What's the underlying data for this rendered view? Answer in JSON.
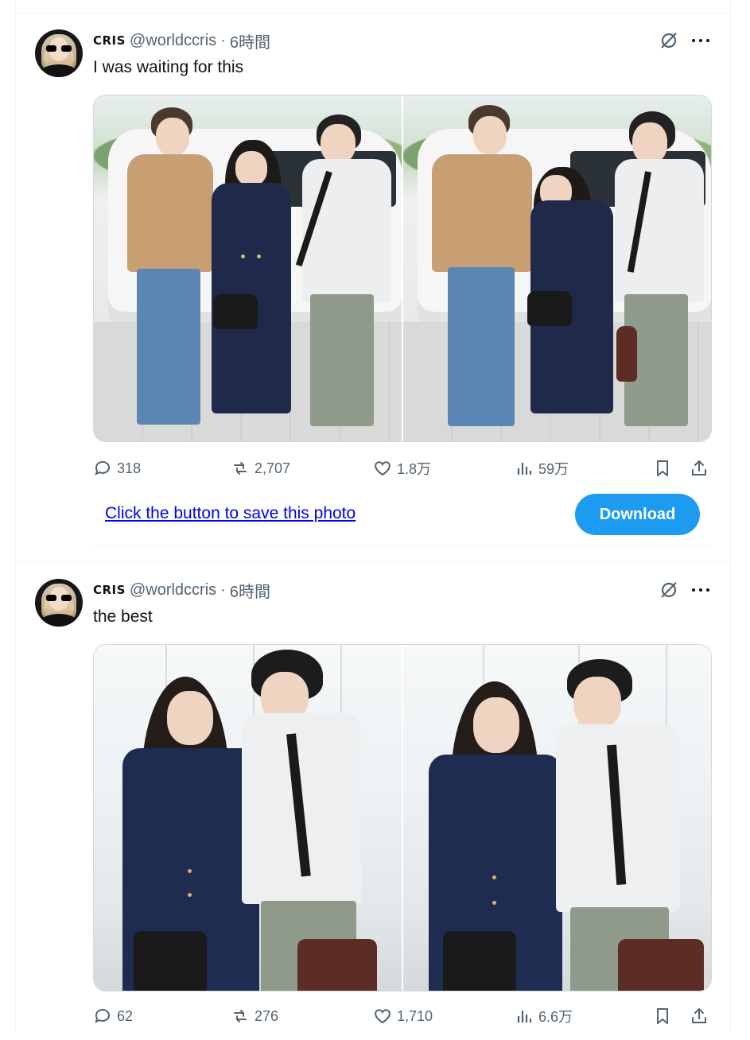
{
  "tweets": [
    {
      "author_name": "CRIS",
      "handle": "@worldccris",
      "separator": "·",
      "time": "6時間",
      "text": "I was waiting for this",
      "stats": {
        "replies": "318",
        "reposts": "2,707",
        "likes": "1.8万",
        "views": "59万"
      },
      "promo": {
        "link_text": "Click the button to save this photo",
        "button_label": "Download"
      }
    },
    {
      "author_name": "CRIS",
      "handle": "@worldccris",
      "separator": "·",
      "time": "6時間",
      "text": "the best",
      "stats": {
        "replies": "62",
        "reposts": "276",
        "likes": "1,710",
        "views": "6.6万"
      }
    }
  ],
  "icons": {
    "reply": "reply-icon",
    "repost": "repost-icon",
    "like": "heart-icon",
    "views": "views-icon",
    "bookmark": "bookmark-icon",
    "share": "share-icon",
    "grok": "grok-icon",
    "more": "more-icon"
  },
  "colors": {
    "accent": "#1d9bf0",
    "muted": "#536471",
    "link": "#0000ee"
  }
}
